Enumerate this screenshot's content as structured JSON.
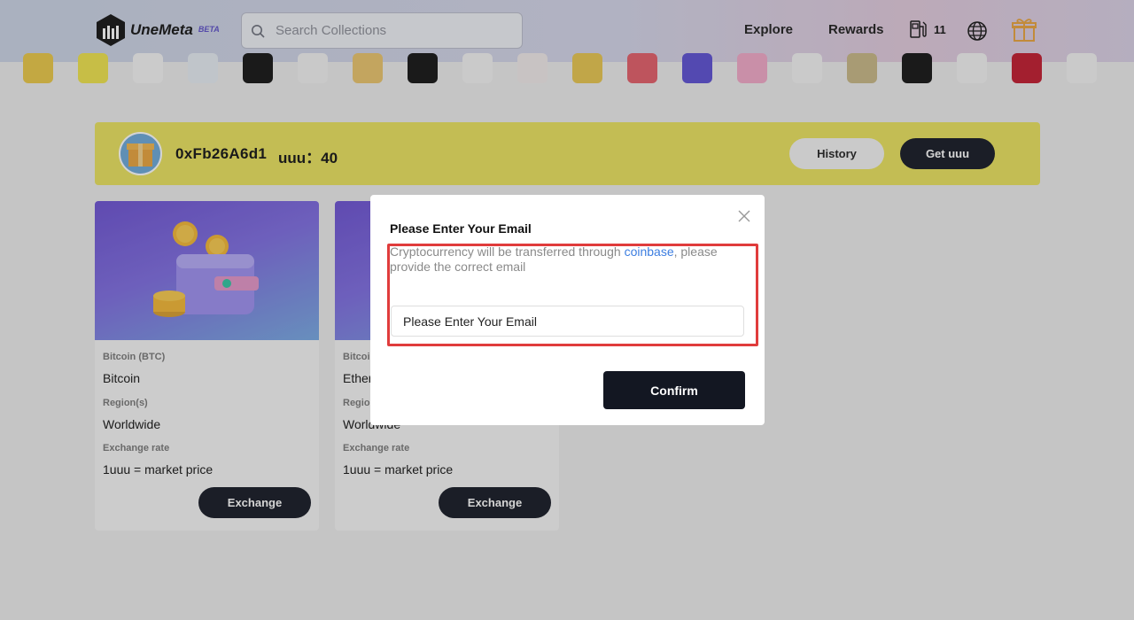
{
  "header": {
    "logo_text": "UneMeta",
    "logo_badge": "BETA",
    "search_placeholder": "Search Collections",
    "nav": {
      "explore": "Explore",
      "rewards": "Rewards"
    },
    "gas_value": "11",
    "accent_color": "#e8a23a"
  },
  "collections_strip": {
    "icons": [
      {
        "name": "collection-1-icon",
        "color": "#e9c744"
      },
      {
        "name": "collection-2-icon",
        "color": "#efe34a"
      },
      {
        "name": "collection-3-icon",
        "color": "#f4f4f4"
      },
      {
        "name": "collection-4-icon",
        "color": "#e6ecf2"
      },
      {
        "name": "collection-5-icon",
        "color": "#111111"
      },
      {
        "name": "collection-6-icon",
        "color": "#f1f1f1"
      },
      {
        "name": "collection-7-icon",
        "color": "#e9c36a"
      },
      {
        "name": "collection-8-icon",
        "color": "#111111"
      },
      {
        "name": "collection-9-icon",
        "color": "#f2f2f2"
      },
      {
        "name": "collection-10-icon",
        "color": "#f0e9e9"
      },
      {
        "name": "collection-11-icon",
        "color": "#e7c44c"
      },
      {
        "name": "collection-12-icon",
        "color": "#e35b67"
      },
      {
        "name": "collection-13-icon",
        "color": "#5a4dd2"
      },
      {
        "name": "collection-14-icon",
        "color": "#f1a7c7"
      },
      {
        "name": "collection-15-icon",
        "color": "#f2f2f2"
      },
      {
        "name": "collection-16-icon",
        "color": "#c7b785"
      },
      {
        "name": "collection-17-icon",
        "color": "#111111"
      },
      {
        "name": "collection-18-icon",
        "color": "#f2f2f2"
      },
      {
        "name": "collection-19-icon",
        "color": "#c0182c"
      },
      {
        "name": "collection-20-icon",
        "color": "#f2f2f2"
      }
    ]
  },
  "banner": {
    "address": "0xFb26A6d1",
    "balance": "uuu：40",
    "history_label": "History",
    "get_label": "Get uuu",
    "background": "#e9e25b"
  },
  "cards": [
    {
      "title_label": "Bitcoin (BTC)",
      "title": "Bitcoin",
      "region_label": "Region(s)",
      "region": "Worldwide",
      "rate_label": "Exchange rate",
      "rate": "1uuu = market price",
      "button": "Exchange"
    },
    {
      "title_label": "Bitcoi",
      "title": "Ether",
      "region_label": "Regio",
      "region": "Worldwide",
      "rate_label": "Exchange rate",
      "rate": "1uuu = market price",
      "button": "Exchange"
    }
  ],
  "modal": {
    "title": "Please Enter Your Email",
    "desc_before": "Cryptocurrency will be transferred through ",
    "desc_link": "coinbase",
    "desc_after": ", please provide the correct email",
    "email_placeholder": "Please Enter Your Email",
    "confirm_label": "Confirm"
  }
}
